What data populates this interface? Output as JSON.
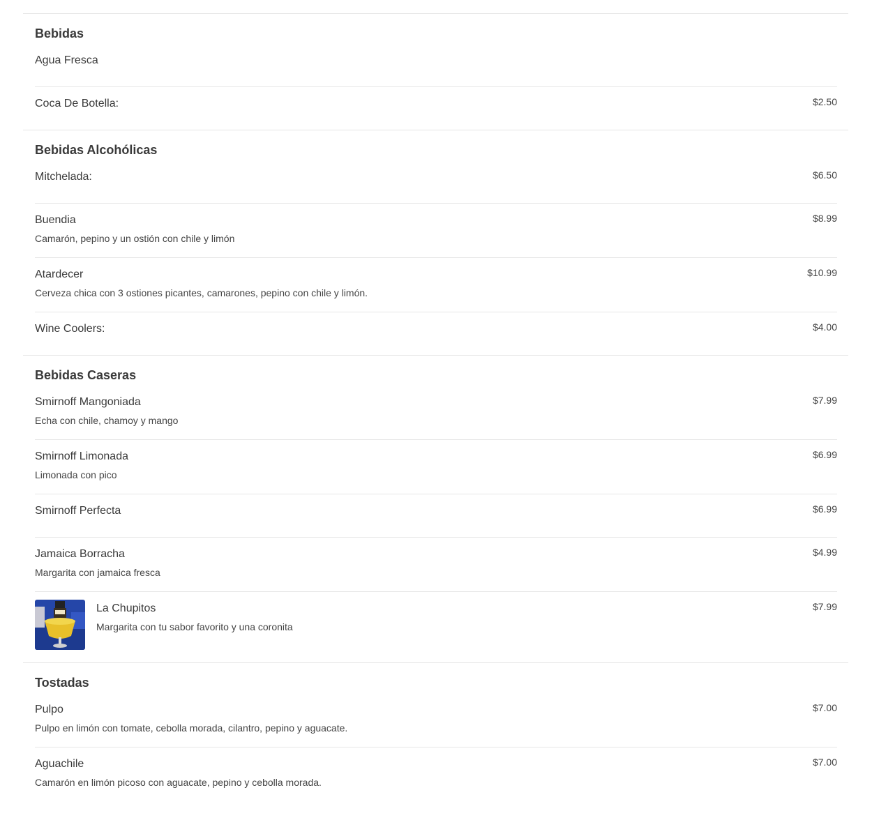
{
  "sections": [
    {
      "title": "Bebidas",
      "items": [
        {
          "name": "Agua Fresca",
          "desc": "",
          "price": ""
        },
        {
          "name": "Coca De Botella:",
          "desc": "",
          "price": "$2.50"
        }
      ]
    },
    {
      "title": "Bebidas Alcohólicas",
      "items": [
        {
          "name": "Mitchelada:",
          "desc": "",
          "price": "$6.50"
        },
        {
          "name": "Buendia",
          "desc": "Camarón, pepino y un ostión con chile y limón",
          "price": "$8.99"
        },
        {
          "name": "Atardecer",
          "desc": "Cerveza chica con 3 ostiones picantes, camarones, pepino con chile y limón.",
          "price": "$10.99"
        },
        {
          "name": "Wine Coolers:",
          "desc": "",
          "price": "$4.00"
        }
      ]
    },
    {
      "title": "Bebidas Caseras",
      "items": [
        {
          "name": "Smirnoff Mangoniada",
          "desc": "Echa con chile, chamoy y mango",
          "price": "$7.99"
        },
        {
          "name": "Smirnoff Limonada",
          "desc": "Limonada con pico",
          "price": "$6.99"
        },
        {
          "name": "Smirnoff Perfecta",
          "desc": "",
          "price": "$6.99"
        },
        {
          "name": "Jamaica Borracha",
          "desc": "Margarita con jamaica fresca",
          "price": "$4.99"
        },
        {
          "name": "La Chupitos",
          "desc": "Margarita con tu sabor favorito y una coronita",
          "price": "$7.99",
          "image": "drink-photo"
        }
      ]
    },
    {
      "title": "Tostadas",
      "items": [
        {
          "name": "Pulpo",
          "desc": "Pulpo en limón con tomate, cebolla morada, cilantro, pepino y aguacate.",
          "price": "$7.00"
        },
        {
          "name": "Aguachile",
          "desc": "Camarón en limón picoso con aguacate, pepino y cebolla morada.",
          "price": "$7.00"
        }
      ]
    }
  ]
}
